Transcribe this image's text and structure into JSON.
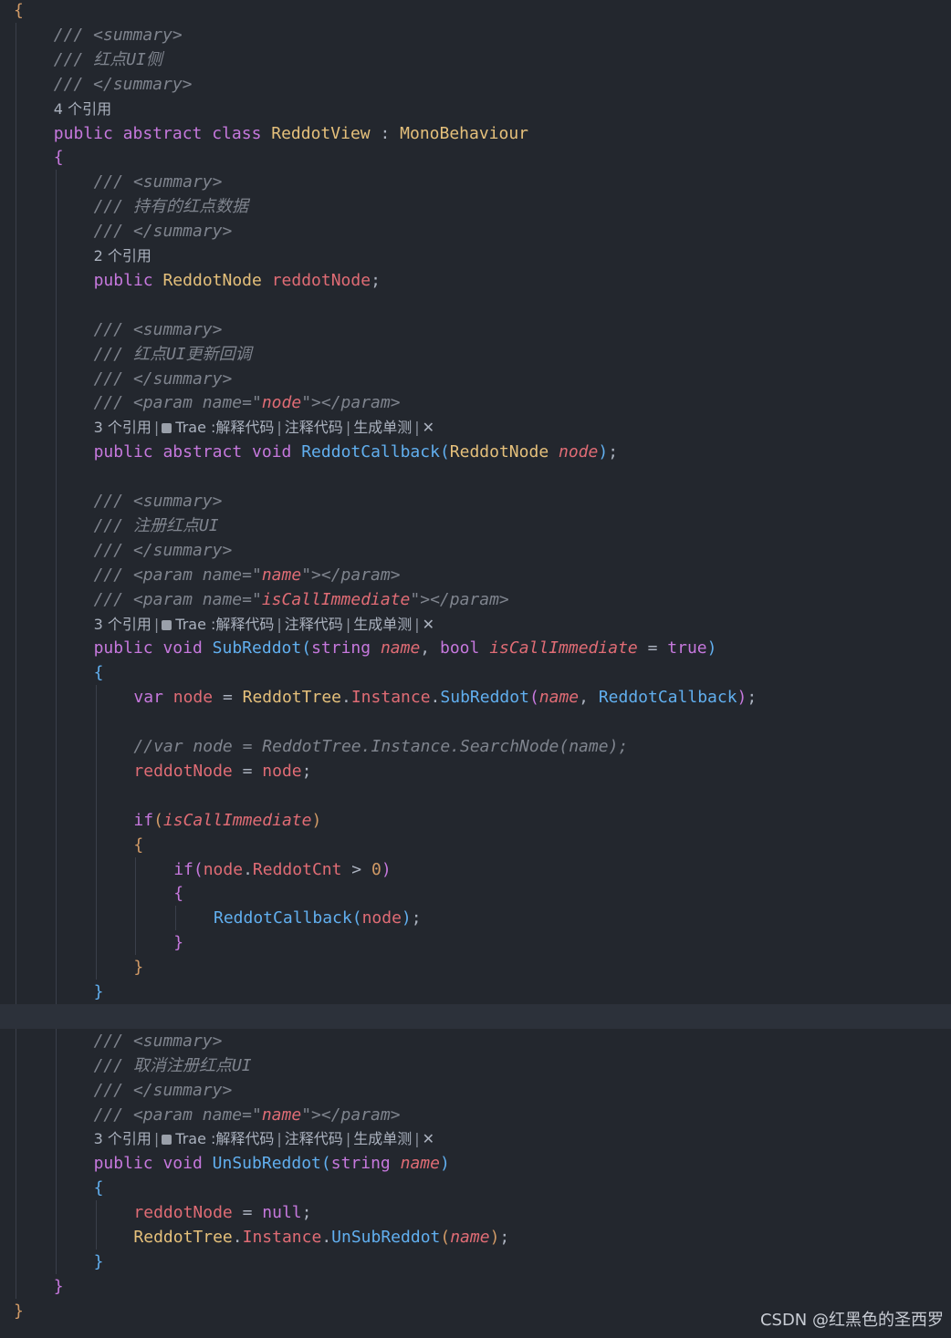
{
  "editor": {
    "lines": [
      {
        "indent": 0,
        "tokens": [
          [
            "{",
            "b1"
          ]
        ]
      },
      {
        "indent": 1,
        "tokens": [
          [
            "/// <summary>",
            "cm"
          ]
        ]
      },
      {
        "indent": 1,
        "tokens": [
          [
            "/// 红点UI侧",
            "cm"
          ]
        ]
      },
      {
        "indent": 1,
        "tokens": [
          [
            "/// </summary>",
            "cm"
          ]
        ]
      },
      {
        "indent": 1,
        "lens": {
          "refs": "4 个引用"
        }
      },
      {
        "indent": 1,
        "tokens": [
          [
            "public",
            "kw"
          ],
          [
            " ",
            ""
          ],
          [
            "abstract",
            "kw"
          ],
          [
            " ",
            ""
          ],
          [
            "class",
            "kw"
          ],
          [
            " ",
            ""
          ],
          [
            "ReddotView",
            "type"
          ],
          [
            " : ",
            "pun"
          ],
          [
            "MonoBehaviour",
            "type"
          ]
        ]
      },
      {
        "indent": 1,
        "tokens": [
          [
            "{",
            "b2"
          ]
        ]
      },
      {
        "indent": 2,
        "tokens": [
          [
            "/// <summary>",
            "cm"
          ]
        ]
      },
      {
        "indent": 2,
        "tokens": [
          [
            "/// 持有的红点数据",
            "cm"
          ]
        ]
      },
      {
        "indent": 2,
        "tokens": [
          [
            "/// </summary>",
            "cm"
          ]
        ]
      },
      {
        "indent": 2,
        "lens": {
          "refs": "2 个引用"
        }
      },
      {
        "indent": 2,
        "tokens": [
          [
            "public",
            "kw"
          ],
          [
            " ",
            ""
          ],
          [
            "ReddotNode",
            "type"
          ],
          [
            " ",
            ""
          ],
          [
            "reddotNode",
            "var"
          ],
          [
            ";",
            "pun"
          ]
        ]
      },
      {
        "indent": 0,
        "tokens": []
      },
      {
        "indent": 2,
        "tokens": [
          [
            "/// <summary>",
            "cm"
          ]
        ]
      },
      {
        "indent": 2,
        "tokens": [
          [
            "/// 红点UI更新回调",
            "cm"
          ]
        ]
      },
      {
        "indent": 2,
        "tokens": [
          [
            "/// </summary>",
            "cm"
          ]
        ]
      },
      {
        "indent": 2,
        "tokens": [
          [
            "/// <param name=\"",
            "cm"
          ],
          [
            "node",
            "str"
          ],
          [
            "\"></param>",
            "cm"
          ]
        ]
      },
      {
        "indent": 2,
        "lens": {
          "refs": "3 个引用",
          "trae": "Trae :解释代码",
          "comment": "注释代码",
          "test": "生成单测",
          "close": "✕"
        }
      },
      {
        "indent": 2,
        "tokens": [
          [
            "public",
            "kw"
          ],
          [
            " ",
            ""
          ],
          [
            "abstract",
            "kw"
          ],
          [
            " ",
            ""
          ],
          [
            "void",
            "kw"
          ],
          [
            " ",
            ""
          ],
          [
            "ReddotCallback",
            "fn"
          ],
          [
            "(",
            "b3"
          ],
          [
            "ReddotNode",
            "type"
          ],
          [
            " ",
            ""
          ],
          [
            "node",
            "param"
          ],
          [
            ")",
            "b3"
          ],
          [
            ";",
            "pun"
          ]
        ]
      },
      {
        "indent": 0,
        "tokens": []
      },
      {
        "indent": 2,
        "tokens": [
          [
            "/// <summary>",
            "cm"
          ]
        ]
      },
      {
        "indent": 2,
        "tokens": [
          [
            "/// 注册红点UI",
            "cm"
          ]
        ]
      },
      {
        "indent": 2,
        "tokens": [
          [
            "/// </summary>",
            "cm"
          ]
        ]
      },
      {
        "indent": 2,
        "tokens": [
          [
            "/// <param name=\"",
            "cm"
          ],
          [
            "name",
            "str"
          ],
          [
            "\"></param>",
            "cm"
          ]
        ]
      },
      {
        "indent": 2,
        "tokens": [
          [
            "/// <param name=\"",
            "cm"
          ],
          [
            "isCallImmediate",
            "str"
          ],
          [
            "\"></param>",
            "cm"
          ]
        ]
      },
      {
        "indent": 2,
        "lens": {
          "refs": "3 个引用",
          "trae": "Trae :解释代码",
          "comment": "注释代码",
          "test": "生成单测",
          "close": "✕"
        }
      },
      {
        "indent": 2,
        "tokens": [
          [
            "public",
            "kw"
          ],
          [
            " ",
            ""
          ],
          [
            "void",
            "kw"
          ],
          [
            " ",
            ""
          ],
          [
            "SubReddot",
            "fn"
          ],
          [
            "(",
            "b3"
          ],
          [
            "string",
            "kw"
          ],
          [
            " ",
            ""
          ],
          [
            "name",
            "param"
          ],
          [
            ", ",
            "pun"
          ],
          [
            "bool",
            "kw"
          ],
          [
            " ",
            ""
          ],
          [
            "isCallImmediate",
            "param"
          ],
          [
            " = ",
            "pun"
          ],
          [
            "true",
            "kw"
          ],
          [
            ")",
            "b3"
          ]
        ]
      },
      {
        "indent": 2,
        "tokens": [
          [
            "{",
            "b3"
          ]
        ]
      },
      {
        "indent": 3,
        "tokens": [
          [
            "var",
            "kw"
          ],
          [
            " ",
            ""
          ],
          [
            "node",
            "var"
          ],
          [
            " = ",
            "pun"
          ],
          [
            "ReddotTree",
            "type"
          ],
          [
            ".",
            "pun"
          ],
          [
            "Instance",
            "var"
          ],
          [
            ".",
            "pun"
          ],
          [
            "SubReddot",
            "fn"
          ],
          [
            "(",
            "b2"
          ],
          [
            "name",
            "param"
          ],
          [
            ", ",
            "pun"
          ],
          [
            "ReddotCallback",
            "fn"
          ],
          [
            ")",
            "b2"
          ],
          [
            ";",
            "pun"
          ]
        ]
      },
      {
        "indent": 0,
        "tokens": []
      },
      {
        "indent": 3,
        "tokens": [
          [
            "//var node = ReddotTree.Instance.SearchNode(name);",
            "cm"
          ]
        ]
      },
      {
        "indent": 3,
        "tokens": [
          [
            "reddotNode",
            "var"
          ],
          [
            " = ",
            "pun"
          ],
          [
            "node",
            "var"
          ],
          [
            ";",
            "pun"
          ]
        ]
      },
      {
        "indent": 0,
        "tokens": []
      },
      {
        "indent": 3,
        "tokens": [
          [
            "if",
            "kw"
          ],
          [
            "(",
            "b1"
          ],
          [
            "isCallImmediate",
            "param"
          ],
          [
            ")",
            "b1"
          ]
        ]
      },
      {
        "indent": 3,
        "tokens": [
          [
            "{",
            "b1"
          ]
        ]
      },
      {
        "indent": 4,
        "tokens": [
          [
            "if",
            "kw"
          ],
          [
            "(",
            "b2"
          ],
          [
            "node",
            "var"
          ],
          [
            ".",
            "pun"
          ],
          [
            "ReddotCnt",
            "var"
          ],
          [
            " > ",
            "pun"
          ],
          [
            "0",
            "num"
          ],
          [
            ")",
            "b2"
          ]
        ]
      },
      {
        "indent": 4,
        "tokens": [
          [
            "{",
            "b2"
          ]
        ]
      },
      {
        "indent": 5,
        "tokens": [
          [
            "ReddotCallback",
            "fn"
          ],
          [
            "(",
            "b3"
          ],
          [
            "node",
            "var"
          ],
          [
            ")",
            "b3"
          ],
          [
            ";",
            "pun"
          ]
        ]
      },
      {
        "indent": 4,
        "tokens": [
          [
            "}",
            "b2"
          ]
        ]
      },
      {
        "indent": 3,
        "tokens": [
          [
            "}",
            "b1"
          ]
        ]
      },
      {
        "indent": 2,
        "tokens": [
          [
            "}",
            "b3"
          ]
        ]
      },
      {
        "indent": 0,
        "tokens": [],
        "highlight": true
      },
      {
        "indent": 2,
        "tokens": [
          [
            "/// <summary>",
            "cm"
          ]
        ]
      },
      {
        "indent": 2,
        "tokens": [
          [
            "/// 取消注册红点UI",
            "cm"
          ]
        ]
      },
      {
        "indent": 2,
        "tokens": [
          [
            "/// </summary>",
            "cm"
          ]
        ]
      },
      {
        "indent": 2,
        "tokens": [
          [
            "/// <param name=\"",
            "cm"
          ],
          [
            "name",
            "str"
          ],
          [
            "\"></param>",
            "cm"
          ]
        ]
      },
      {
        "indent": 2,
        "lens": {
          "refs": "3 个引用",
          "trae": "Trae :解释代码",
          "comment": "注释代码",
          "test": "生成单测",
          "close": "✕"
        }
      },
      {
        "indent": 2,
        "tokens": [
          [
            "public",
            "kw"
          ],
          [
            " ",
            ""
          ],
          [
            "void",
            "kw"
          ],
          [
            " ",
            ""
          ],
          [
            "UnSubReddot",
            "fn"
          ],
          [
            "(",
            "b3"
          ],
          [
            "string",
            "kw"
          ],
          [
            " ",
            ""
          ],
          [
            "name",
            "param"
          ],
          [
            ")",
            "b3"
          ]
        ]
      },
      {
        "indent": 2,
        "tokens": [
          [
            "{",
            "b3"
          ]
        ]
      },
      {
        "indent": 3,
        "tokens": [
          [
            "reddotNode",
            "var"
          ],
          [
            " = ",
            "pun"
          ],
          [
            "null",
            "kw"
          ],
          [
            ";",
            "pun"
          ]
        ]
      },
      {
        "indent": 3,
        "tokens": [
          [
            "ReddotTree",
            "type"
          ],
          [
            ".",
            "pun"
          ],
          [
            "Instance",
            "var"
          ],
          [
            ".",
            "pun"
          ],
          [
            "UnSubReddot",
            "fn"
          ],
          [
            "(",
            "b1"
          ],
          [
            "name",
            "param"
          ],
          [
            ")",
            "b1"
          ],
          [
            ";",
            "pun"
          ]
        ]
      },
      {
        "indent": 2,
        "tokens": [
          [
            "}",
            "b3"
          ]
        ]
      },
      {
        "indent": 1,
        "tokens": [
          [
            "}",
            "b2"
          ]
        ]
      },
      {
        "indent": 0,
        "tokens": [
          [
            "}",
            "b1"
          ]
        ]
      }
    ]
  },
  "watermark": "CSDN @红黑色的圣西罗"
}
